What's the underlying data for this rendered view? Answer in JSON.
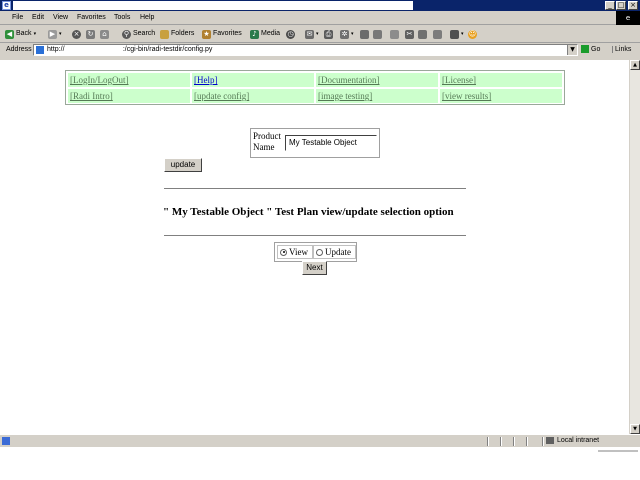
{
  "window": {
    "title": ""
  },
  "menu": {
    "items": [
      "File",
      "Edit",
      "View",
      "Favorites",
      "Tools",
      "Help"
    ]
  },
  "toolbar": {
    "back": "Back",
    "search": "Search",
    "folders": "Folders",
    "favorites": "Favorites",
    "media": "Media"
  },
  "address": {
    "label": "Address",
    "url": "http://                              :/cgi-bin/radi-testdir/config.py",
    "go": "Go",
    "links": "Links"
  },
  "nav": {
    "row1": [
      "[LogIn/LogOut]",
      "[Help]",
      "[Documentation]",
      "[License]"
    ],
    "row2": [
      "[Radi Intro]",
      "[update config]",
      "[image testing]",
      "[view results]"
    ]
  },
  "form": {
    "product_label": "Product Name",
    "product_value": "My Testable Object",
    "update_button": "update",
    "heading": "\" My Testable Object \" Test Plan view/update selection option",
    "radio_view": "View",
    "radio_update": "Update",
    "selected": "View",
    "next_button": "Next"
  },
  "status": {
    "zone": "Local intranet"
  },
  "colors": {
    "nav_bg": "#ccffcc",
    "nav_link": "#557a55",
    "title_bar": "#0a246a",
    "chrome": "#d4d0c8"
  }
}
